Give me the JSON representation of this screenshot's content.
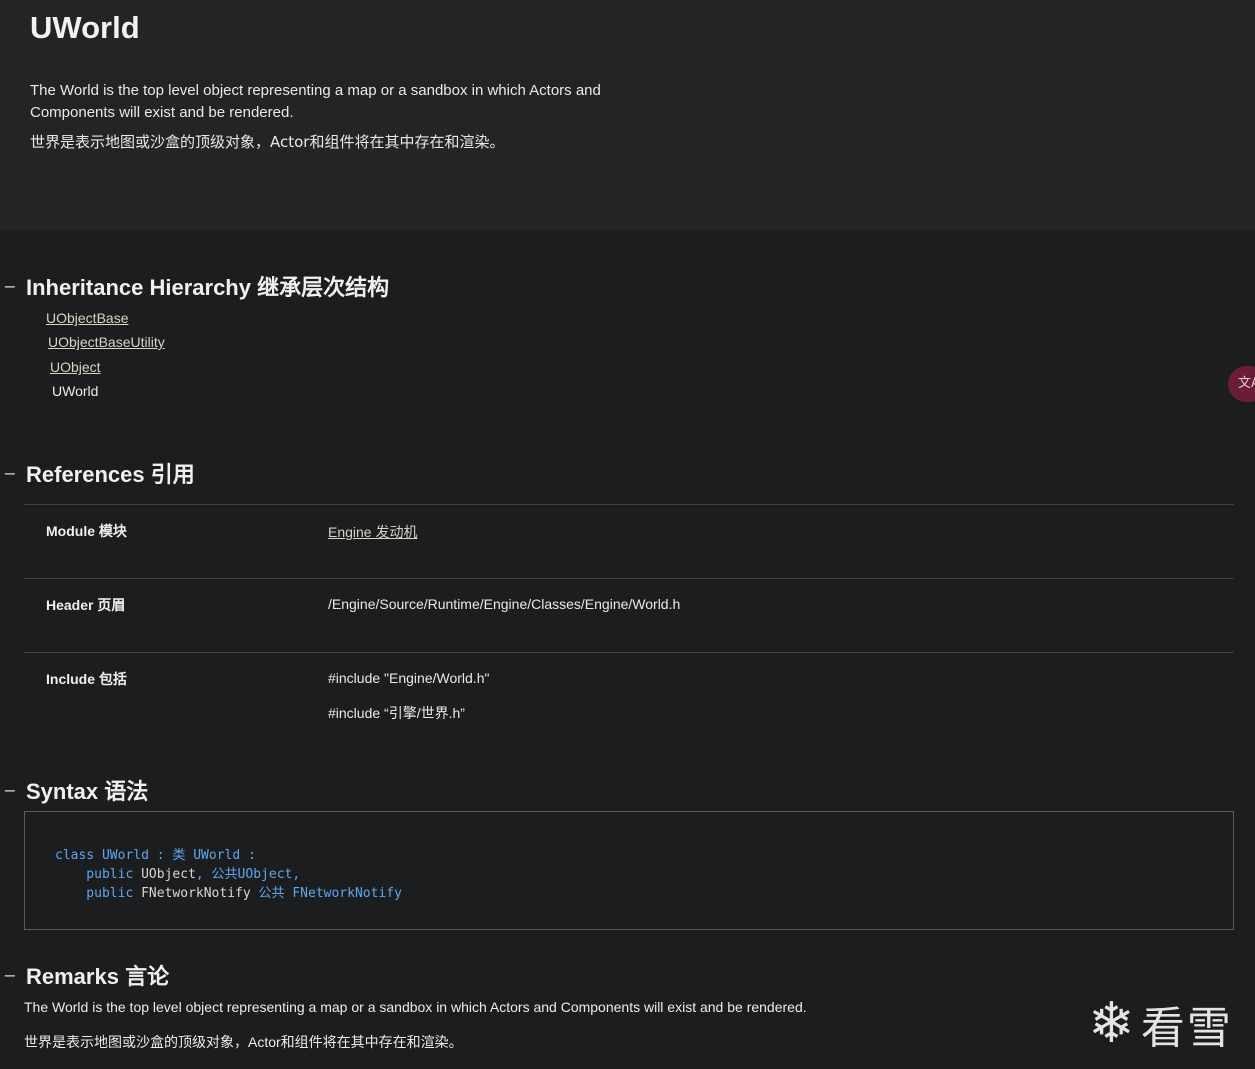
{
  "header": {
    "title": "UWorld",
    "description_en": "The World is the top level object representing a map or a sandbox in which Actors and Components will exist and be rendered.",
    "description_cn": "世界是表示地图或沙盒的顶级对象，Actor和组件将在其中存在和渲染。"
  },
  "sections": {
    "inheritance": {
      "collapse_icon": "−",
      "title": "Inheritance Hierarchy 继承层次结构"
    },
    "references": {
      "collapse_icon": "−",
      "title": "References 引用"
    },
    "syntax": {
      "collapse_icon": "−",
      "title": "Syntax 语法"
    },
    "remarks": {
      "collapse_icon": "−",
      "title": "Remarks 言论"
    }
  },
  "inheritance": {
    "items": [
      {
        "label": "UObjectBase",
        "link": true
      },
      {
        "label": "UObjectBaseUtility",
        "link": true
      },
      {
        "label": "UObject",
        "link": true
      },
      {
        "label": "UWorld",
        "link": false
      }
    ]
  },
  "references": {
    "rows": [
      {
        "label": "Module 模块",
        "values": [
          "Engine 发动机"
        ]
      },
      {
        "label": "Header 页眉",
        "values": [
          "/Engine/Source/Runtime/Engine/Classes/Engine/World.h"
        ]
      },
      {
        "label": "Include 包括",
        "values": [
          "#include \"Engine/World.h\"",
          "#include “引擎/世界.h”"
        ]
      }
    ]
  },
  "syntax": {
    "line1_kw": "class UWorld : 类 UWorld :",
    "line2_kw1": "    public",
    "line2_tx": " UObject",
    "line2_kw2": ", 公共UObject,",
    "line3_kw1": "    public",
    "line3_tx": " FNetworkNotify",
    "line3_kw2": " 公共 FNetworkNotify"
  },
  "remarks": {
    "text_en": "The World is the top level object representing a map or a sandbox in which Actors and Components will exist and be rendered.",
    "text_cn": "世界是表示地图或沙盒的顶级对象，Actor和组件将在其中存在和渲染。"
  },
  "translate_button": {
    "label": "文A",
    "icon": "translate-icon"
  },
  "watermark": {
    "icon": "snowflake-icon",
    "glyph": "❄",
    "text": "看雪"
  },
  "colors": {
    "accent_link": "#d9d4c3",
    "code_keyword": "#5aa7f0",
    "background": "#1c1d1f"
  }
}
